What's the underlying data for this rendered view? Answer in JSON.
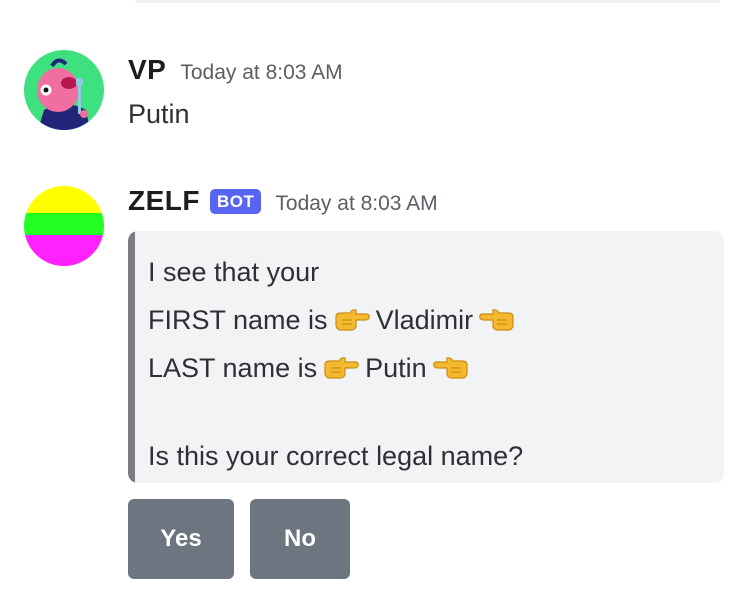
{
  "messages": [
    {
      "username": "VP",
      "timestamp": "Today at 8:03 AM",
      "content": "Putin",
      "avatar_icon": "pink-creature-avatar"
    },
    {
      "username": "ZELF",
      "badge": "BOT",
      "timestamp": "Today at 8:03 AM",
      "avatar_icon": "tricolor-ball-avatar",
      "embed": {
        "line1": "I see that your",
        "line2_prefix": "FIRST name is",
        "line2_value": "Vladimir",
        "line3_prefix": "LAST name is",
        "line3_value": "Putin",
        "question": "Is this your correct legal name?",
        "left_emoji": "point-right-emoji",
        "right_emoji": "point-left-emoji"
      },
      "buttons": [
        {
          "label": "Yes"
        },
        {
          "label": "No"
        }
      ]
    }
  ],
  "colors": {
    "bot_badge": "#5865f2",
    "embed_bar": "#7b7d82",
    "button": "#6d7580",
    "embed_bg": "#f2f3f5"
  }
}
